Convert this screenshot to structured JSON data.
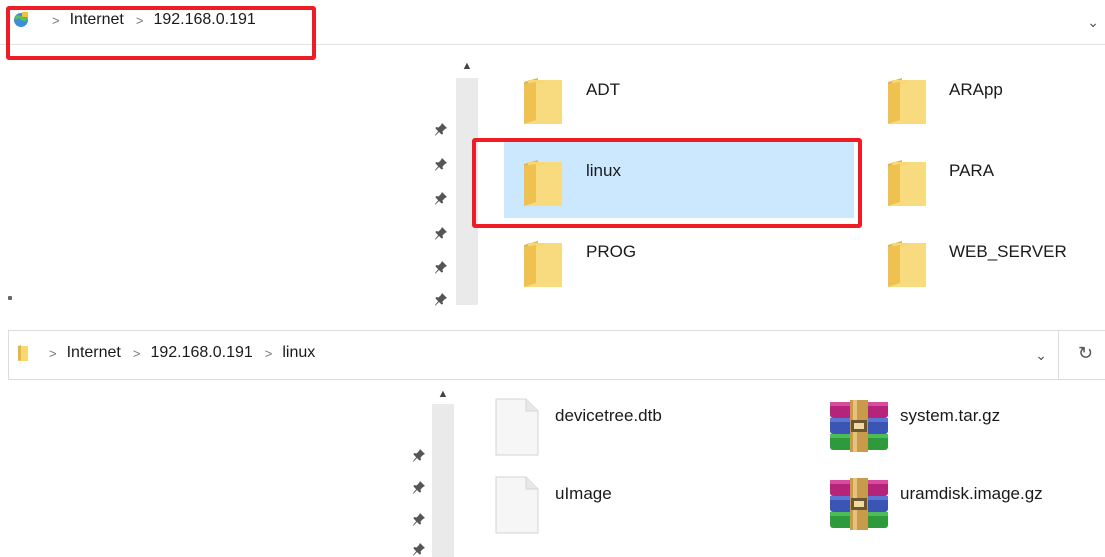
{
  "top": {
    "breadcrumb": [
      "Internet",
      "192.168.0.191"
    ],
    "items": [
      {
        "name": "ADT",
        "type": "folder",
        "selected": false
      },
      {
        "name": "ARApp",
        "type": "folder",
        "selected": false
      },
      {
        "name": "linux",
        "type": "folder",
        "selected": true
      },
      {
        "name": "PARA",
        "type": "folder",
        "selected": false
      },
      {
        "name": "PROG",
        "type": "folder",
        "selected": false
      },
      {
        "name": "WEB_SERVER",
        "type": "folder",
        "selected": false
      }
    ]
  },
  "bottom": {
    "breadcrumb": [
      "Internet",
      "192.168.0.191",
      "linux"
    ],
    "items": [
      {
        "name": "devicetree.dtb",
        "type": "file"
      },
      {
        "name": "system.tar.gz",
        "type": "archive"
      },
      {
        "name": "uImage",
        "type": "file"
      },
      {
        "name": "uramdisk.image.gz",
        "type": "archive"
      }
    ]
  },
  "icons": {
    "network": "network-location-icon",
    "folder": "folder-icon",
    "pin": "pin-icon",
    "dropdown": "chevron-down-icon",
    "refresh": "refresh-icon",
    "scroll_up": "scroll-up-arrow-icon"
  },
  "colors": {
    "highlight": "#ee1c25",
    "selection": "#cce8ff",
    "folder": "#f8d775"
  }
}
